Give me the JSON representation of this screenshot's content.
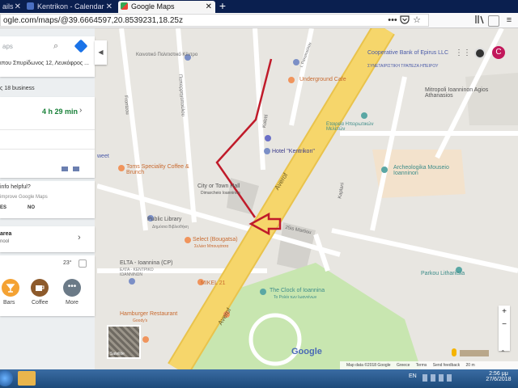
{
  "browser": {
    "tabs": [
      {
        "label": "ails"
      },
      {
        "label": "Kentrikon - Calendar"
      },
      {
        "label": "Google Maps"
      }
    ],
    "new_tab": "+",
    "close_glyph": "✕",
    "url": "ogle.com/maps/@39.6664597,20.8539231,18.25z"
  },
  "sidebar": {
    "search_placeholder": "aps",
    "place_address": "ιπου Σπυρίδωνος 12, Λευκόφρος ...",
    "businesses": "ς 18 business",
    "duration": "4 h 29 min",
    "helpful_q": "info helpful?",
    "improve": "improve Google Maps",
    "yes": "ES",
    "no": "NO",
    "area_title": "area",
    "area_sub": "nool",
    "temperature": "23°",
    "categories": [
      {
        "label": "Bars",
        "color": "#f4a233"
      },
      {
        "label": "Coffee",
        "color": "#8d5a2b"
      },
      {
        "label": "More",
        "color": "#6b7a87"
      }
    ]
  },
  "map": {
    "places": {
      "koinotiko": "Κοινοτικό Πολιτιστικό Κέντρο",
      "coop_bank": "Cooperative Bank of Epirus LLC",
      "coop_bank_gr": "ΣΥΝΕΤΑΙΡΙΣΤΙΚΗ ΤΡΑΠΕΖΑ ΗΠΕΙΡΟΥ",
      "underground": "Underground Cafe",
      "metropoli": "Mitropoli Ioanninon Agios Athanasios",
      "etaireia": "Εταιρεία Ηπειρωτικών Μελετών",
      "hotel": "Hotel \"Kentrikon\"",
      "toms": "Toms Speciality Coffee & Brunch",
      "city_hall": "City or Town Hall",
      "dimarcheio": "Dimarcheio Ioanninon",
      "archeologika": "Archeologika Mouseio Ioanninon",
      "library": "Public Library",
      "library_gr": "Δημόσια Βιβλιοθήκη",
      "select": "Select (Bougatsa)",
      "select_gr": "Σελέκτ Μπουγάτσα",
      "elta": "ELTA - Ioannina (CP)",
      "elta_gr": "ΕΛΤΑ - ΚΕΝΤΡΙΚΟ ΙΩΑΝΝΙΝΩΝ",
      "mikel": "MIKEL 21",
      "clock": "The Clock of Ioannina",
      "clock_gr": "Το Ρολόι των Ιωαννίνων",
      "hamburger": "Hamburger Restaurant",
      "goodys": "Goody's",
      "parkou": "Parkou Litharitsia",
      "sweet": "weet"
    },
    "streets": {
      "averof1": "Averof",
      "averof2": "Averof",
      "marinou": "25is Martiou",
      "frontzou": "Frontzou",
      "paparigopoulou": "Παπαρρηγοπούλου",
      "koletti": "Koletti",
      "kaplani": "Kaplani",
      "rakopoulou": "Ι. Ρακοπούλου"
    },
    "google_logo": "Google",
    "footer": [
      "Map data ©2018 Google",
      "Greece",
      "Terms",
      "Send feedback",
      "20 m"
    ],
    "imagery_label": "Satellite"
  },
  "taskbar": {
    "lang": "EN",
    "time": "2:56 μμ",
    "date": "27/6/2018"
  },
  "colors": {
    "main_road": "#f6d66b",
    "park": "#c8e6b0",
    "annotation": "#c01b2a",
    "panel_green": "#188038"
  }
}
